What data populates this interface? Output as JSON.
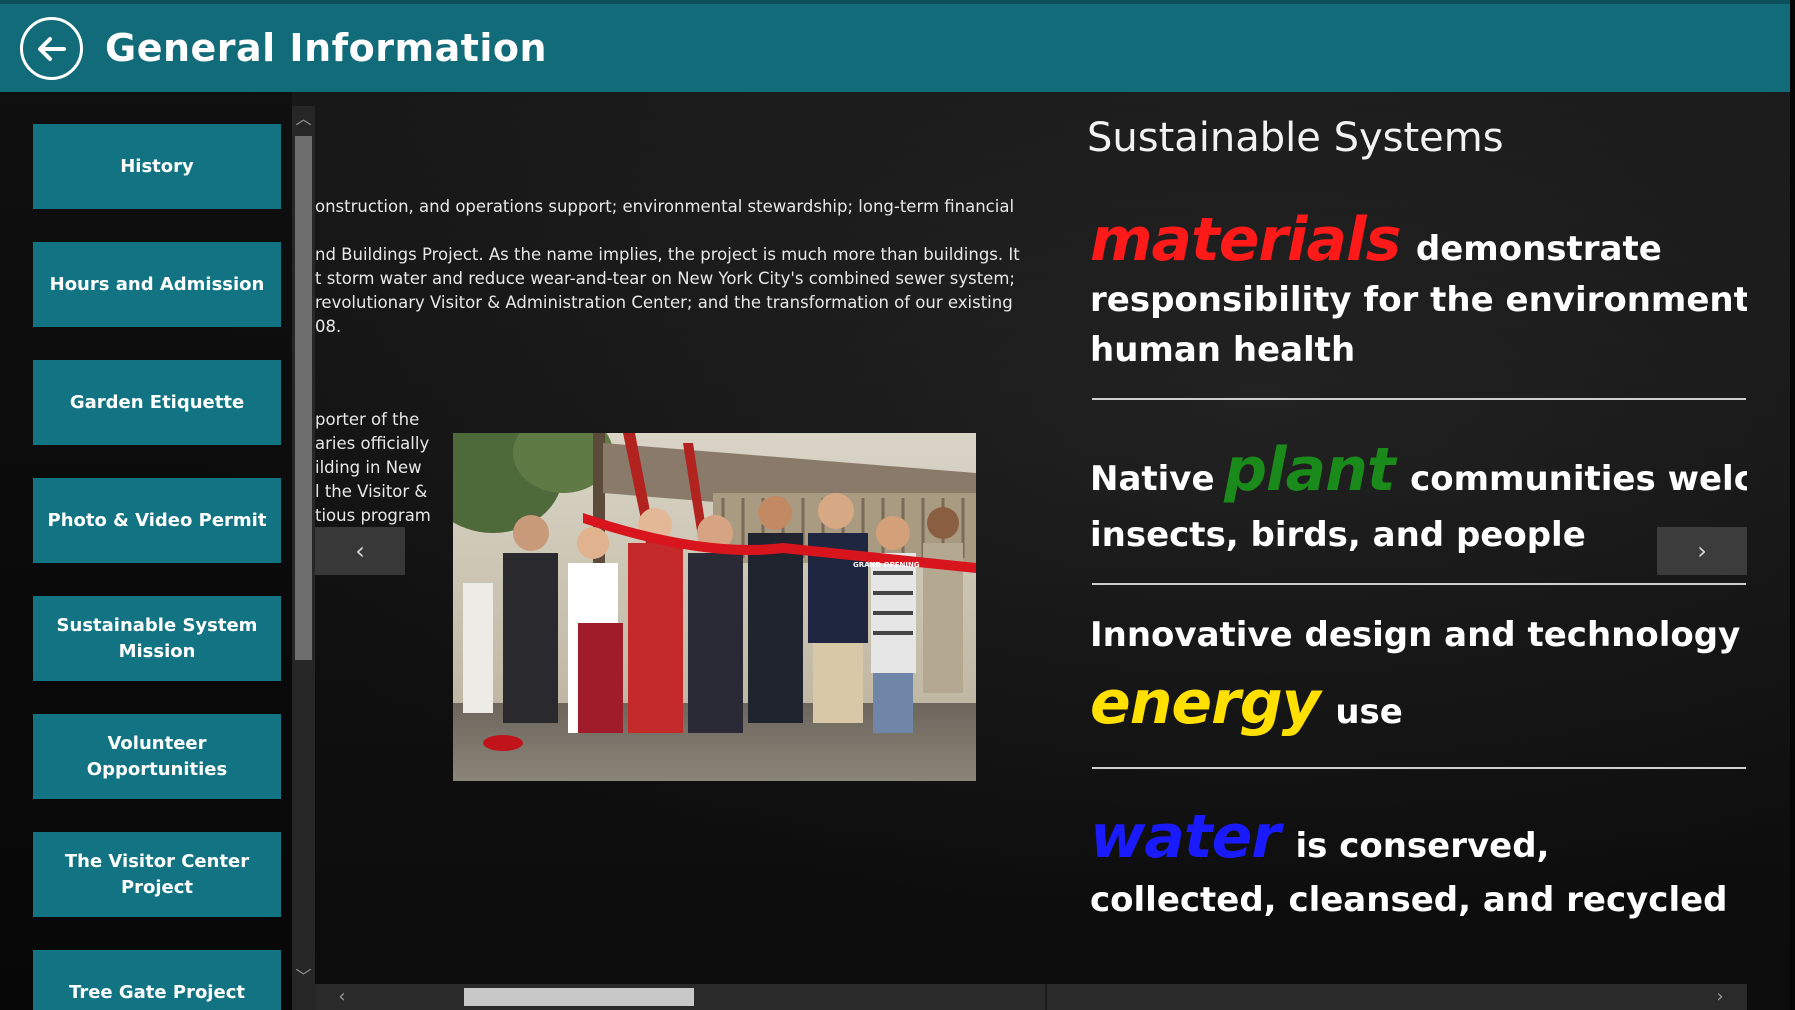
{
  "header": {
    "title": "General Information",
    "back_icon": "arrow-left-circle-icon"
  },
  "colors": {
    "header_bg": "#116b79",
    "nav_button_bg": "#127483",
    "materials": "#ff1a1a",
    "plant": "#1a8a1a",
    "energy": "#ffe000",
    "water": "#1a1aff"
  },
  "sidebar": {
    "items": [
      {
        "label": "History"
      },
      {
        "label": "Hours and Admission"
      },
      {
        "label": "Garden Etiquette"
      },
      {
        "label": "Photo & Video Permit"
      },
      {
        "label": "Sustainable System Mission"
      },
      {
        "label": "Volunteer Opportunities"
      },
      {
        "label": "The Visitor Center Project"
      },
      {
        "label": "Tree Gate Project"
      }
    ]
  },
  "article": {
    "para1": "onstruction, and operations support; environmental stewardship; long-term financial",
    "para2": [
      "nd Buildings Project. As the name implies, the project is much more than buildings. It",
      "t storm water and reduce wear-and-tear on New York City's combined sewer system;",
      "revolutionary Visitor & Administration Center; and the transformation of our existing",
      "08."
    ],
    "para3": [
      "porter of the",
      "aries officially",
      "ilding in New",
      "l the Visitor &",
      "tious program"
    ],
    "photo_ribbon_text": "GRAND OPENING"
  },
  "sustainable": {
    "heading": "Sustainable Systems",
    "items": [
      {
        "keyword": "materials",
        "after_keyword": "demonstrate",
        "lines": [
          "responsibility for the environment and",
          "human health"
        ]
      },
      {
        "before_keyword": "Native",
        "keyword": "plant",
        "after_keyword": "communities welcome",
        "lines": [
          "insects, birds, and people"
        ]
      },
      {
        "first_line": "Innovative design and technology reduce",
        "keyword": "energy",
        "after_keyword": "use"
      },
      {
        "keyword": "water",
        "after_keyword": "is conserved,",
        "lines": [
          "collected, cleansed, and recycled"
        ]
      }
    ]
  },
  "navigation": {
    "prev_glyph": "‹",
    "next_glyph": "›",
    "scroll_up_glyph": "︿",
    "scroll_down_glyph": "﹀",
    "scroll_left_glyph": "‹",
    "scroll_right_glyph": "›"
  }
}
